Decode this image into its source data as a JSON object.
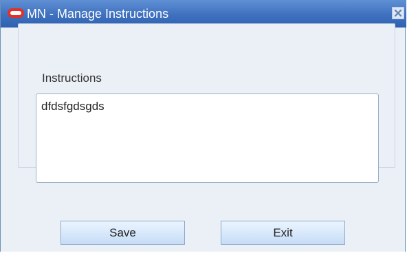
{
  "window": {
    "title": "MN - Manage Instructions",
    "close_icon": "close-icon",
    "oracle_icon": "oracle-icon"
  },
  "form": {
    "instructions_label": "Instructions",
    "instructions_value": "dfdsfgdsgds"
  },
  "buttons": {
    "save_label": "Save",
    "exit_label": "Exit"
  },
  "colors": {
    "titlebar": "#3f71bf",
    "background": "#eaf0f6",
    "button_fill": "#d9e9fb",
    "icon_red": "#e0312a"
  }
}
